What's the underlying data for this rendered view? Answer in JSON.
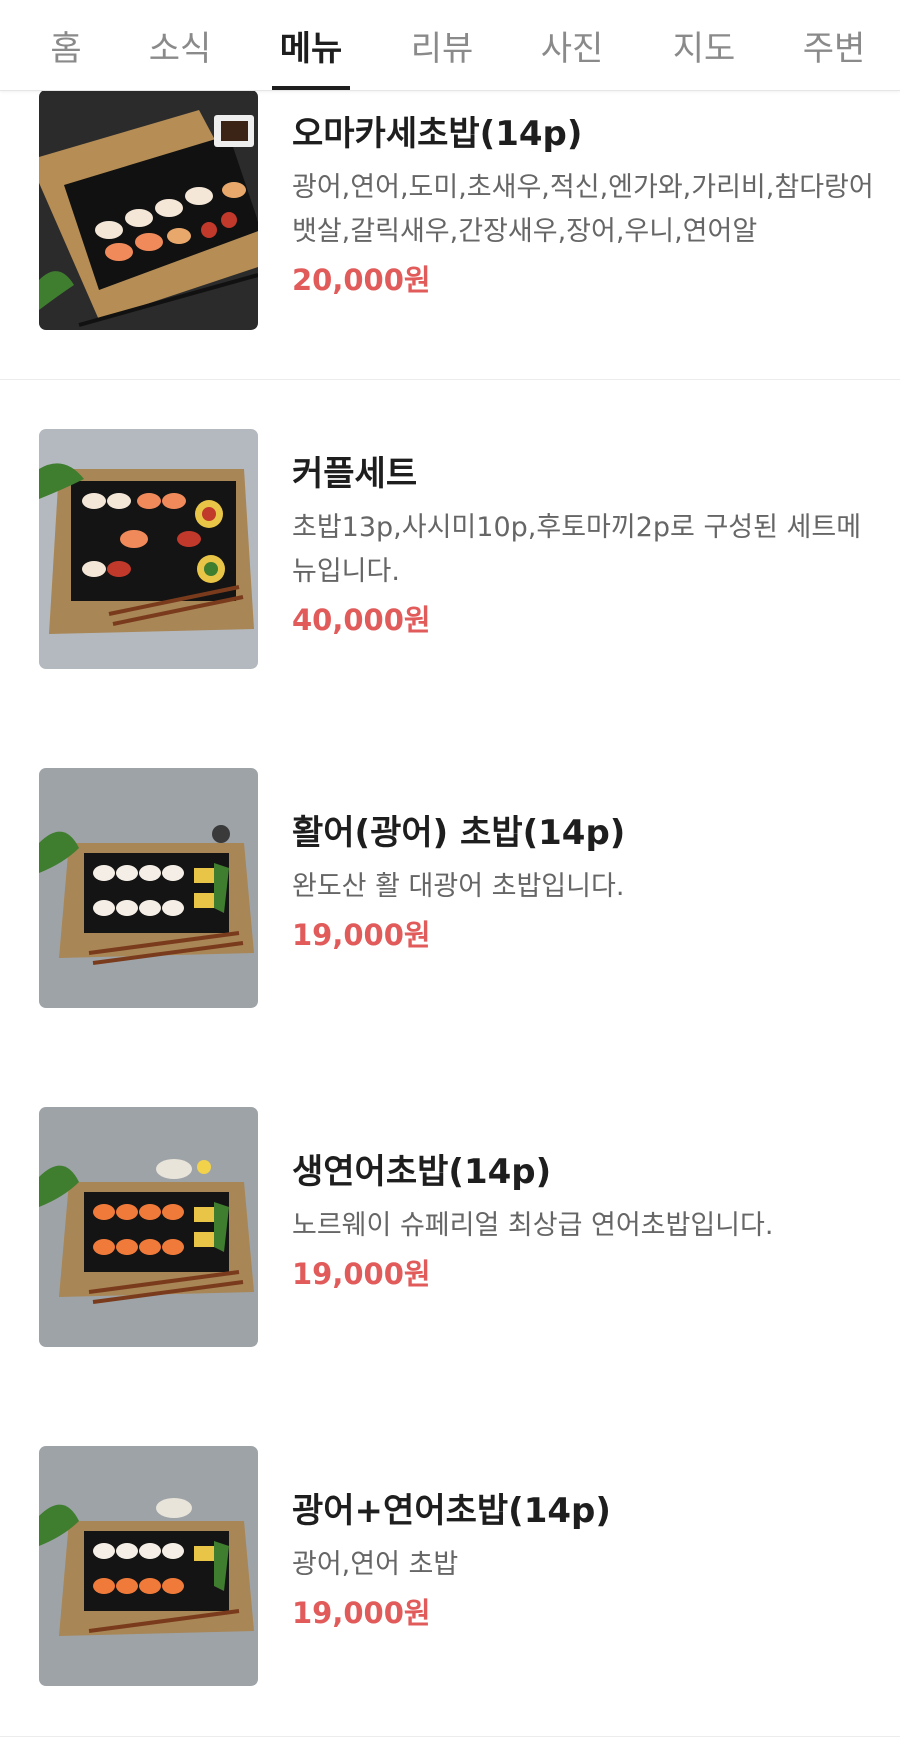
{
  "tabs": [
    {
      "label": "홈",
      "active": false
    },
    {
      "label": "소식",
      "active": false
    },
    {
      "label": "메뉴",
      "active": true
    },
    {
      "label": "리뷰",
      "active": false
    },
    {
      "label": "사진",
      "active": false
    },
    {
      "label": "지도",
      "active": false
    },
    {
      "label": "주변",
      "active": false
    }
  ],
  "colors": {
    "price": "#e25b5b",
    "active_tab": "#1e1e1e",
    "inactive_tab": "#8a8a8a"
  },
  "menu": {
    "items": [
      {
        "title": "오마카세초밥(14p)",
        "description": "광어,연어,도미,초새우,적신,엔가와,가리비,참다랑어뱃살,갈릭새우,간장새우,장어,우니,연어알",
        "price": "20,000원",
        "image": "omakase-sushi-photo"
      },
      {
        "title": "커플세트",
        "description": "초밥13p,사시미10p,후토마끼2p로 구성된 세트메뉴입니다.",
        "price": "40,000원",
        "image": "couple-set-photo"
      },
      {
        "title": "활어(광어) 초밥(14p)",
        "description": "완도산 활 대광어 초밥입니다.",
        "price": "19,000원",
        "image": "flatfish-sushi-photo"
      },
      {
        "title": "생연어초밥(14p)",
        "description": "노르웨이 슈페리얼 최상급 연어초밥입니다.",
        "price": "19,000원",
        "image": "salmon-sushi-photo"
      },
      {
        "title": "광어+연어초밥(14p)",
        "description": "광어,연어 초밥",
        "price": "19,000원",
        "image": "flatfish-salmon-sushi-photo"
      }
    ]
  }
}
